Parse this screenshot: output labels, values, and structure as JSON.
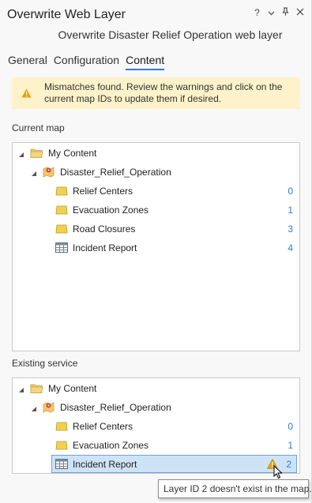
{
  "window": {
    "title": "Overwrite Web Layer",
    "help_label": "?",
    "subtitle": "Overwrite Disaster Relief Operation web layer"
  },
  "tabs": [
    {
      "label": "General",
      "active": false
    },
    {
      "label": "Configuration",
      "active": false
    },
    {
      "label": "Content",
      "active": true
    }
  ],
  "warning": {
    "text": "Mismatches found. Review the warnings and click on the current map IDs to update them if desired.",
    "icon": "warning-triangle-icon",
    "bg_color": "#fdf2c9"
  },
  "current_map": {
    "label": "Current map",
    "root": "My Content",
    "layer_group": "Disaster_Relief_Operation",
    "items": [
      {
        "label": "Relief Centers",
        "icon": "feature-layer-icon",
        "id": "0"
      },
      {
        "label": "Evacuation Zones",
        "icon": "feature-layer-icon",
        "id": "1"
      },
      {
        "label": "Road Closures",
        "icon": "feature-layer-icon",
        "id": "3"
      },
      {
        "label": "Incident Report",
        "icon": "table-icon",
        "id": "4"
      }
    ]
  },
  "existing_service": {
    "label": "Existing service",
    "root": "My Content",
    "layer_group": "Disaster_Relief_Operation",
    "items": [
      {
        "label": "Relief Centers",
        "icon": "feature-layer-icon",
        "id": "0"
      },
      {
        "label": "Evacuation Zones",
        "icon": "feature-layer-icon",
        "id": "1"
      },
      {
        "label": "Incident Report",
        "icon": "table-icon",
        "id": "2",
        "warning": true,
        "selected": true
      }
    ]
  },
  "tooltip": {
    "text": "Layer ID 2 doesn't exist in the map."
  },
  "colors": {
    "accent": "#2f7bd6",
    "selected_bg": "#cfe3f6",
    "warning_icon": "#e8a200"
  }
}
